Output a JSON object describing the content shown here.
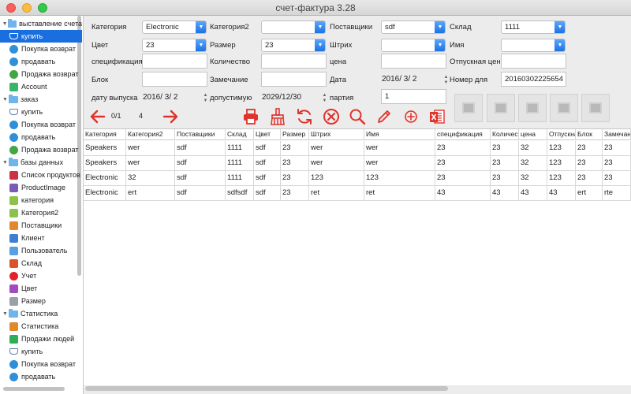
{
  "window": {
    "title": "счет-фактура 3.28"
  },
  "sidebar": {
    "items": [
      {
        "label": "выставление счета",
        "kind": "group",
        "icon": "folder-icon"
      },
      {
        "label": "купить",
        "kind": "item",
        "icon": "cart-icon",
        "selected": true
      },
      {
        "label": "Покупка возврат",
        "kind": "item",
        "icon": "globe-icon"
      },
      {
        "label": "продавать",
        "kind": "item",
        "icon": "globe-icon"
      },
      {
        "label": "Продажа возврат",
        "kind": "item",
        "icon": "refresh-icon"
      },
      {
        "label": "Account",
        "kind": "item",
        "icon": "account-icon"
      },
      {
        "label": "заказ",
        "kind": "group",
        "icon": "folder-icon"
      },
      {
        "label": "купить",
        "kind": "item",
        "icon": "cart-icon"
      },
      {
        "label": "Покупка возврат",
        "kind": "item",
        "icon": "globe-icon"
      },
      {
        "label": "продавать",
        "kind": "item",
        "icon": "globe-icon"
      },
      {
        "label": "Продажа возврат",
        "kind": "item",
        "icon": "refresh-icon"
      },
      {
        "label": "базы данных",
        "kind": "group",
        "icon": "folder-icon"
      },
      {
        "label": "Список продуктов",
        "kind": "item",
        "icon": "products-icon"
      },
      {
        "label": "ProductImage",
        "kind": "item",
        "icon": "image-icon"
      },
      {
        "label": "категория",
        "kind": "item",
        "icon": "list-icon"
      },
      {
        "label": "Категория2",
        "kind": "item",
        "icon": "list-icon"
      },
      {
        "label": "Поставщики",
        "kind": "item",
        "icon": "suppliers-icon"
      },
      {
        "label": "Клиент",
        "kind": "item",
        "icon": "clients-icon"
      },
      {
        "label": "Пользователь",
        "kind": "item",
        "icon": "user-icon"
      },
      {
        "label": "Склад",
        "kind": "item",
        "icon": "warehouse-icon"
      },
      {
        "label": "Учет",
        "kind": "item",
        "icon": "record-icon"
      },
      {
        "label": "Цвет",
        "kind": "item",
        "icon": "color-icon"
      },
      {
        "label": "Размер",
        "kind": "item",
        "icon": "size-icon"
      },
      {
        "label": "Статистика",
        "kind": "group",
        "icon": "folder-icon"
      },
      {
        "label": "Статистика",
        "kind": "item",
        "icon": "chart-icon"
      },
      {
        "label": "Продажи людей",
        "kind": "item",
        "icon": "sales-people-icon"
      },
      {
        "label": "купить",
        "kind": "item",
        "icon": "cart-icon"
      },
      {
        "label": "Покупка возврат",
        "kind": "item",
        "icon": "globe-icon"
      },
      {
        "label": "продавать",
        "kind": "item",
        "icon": "globe-icon"
      }
    ]
  },
  "form": {
    "category": {
      "label": "Категория",
      "value": "Electronic"
    },
    "category2": {
      "label": "Категория2",
      "value": ""
    },
    "suppliers": {
      "label": "Поставщики",
      "value": "sdf"
    },
    "warehouse": {
      "label": "Склад",
      "value": "1111"
    },
    "color": {
      "label": "Цвет",
      "value": "23"
    },
    "size": {
      "label": "Размер",
      "value": "23"
    },
    "barcode": {
      "label": "Штрих",
      "value": ""
    },
    "name": {
      "label": "Имя",
      "value": ""
    },
    "specification": {
      "label": "спецификация",
      "value": ""
    },
    "quantity": {
      "label": "Количество",
      "value": ""
    },
    "price": {
      "label": "цена",
      "value": ""
    },
    "sale_price": {
      "label": "Отпускная цена",
      "value": ""
    },
    "block": {
      "label": "Блок",
      "value": ""
    },
    "remark": {
      "label": "Замечание",
      "value": ""
    },
    "date": {
      "label": "Дата",
      "value": "2016/  3/  2"
    },
    "number": {
      "label": "Номер для",
      "value": "20160302225654"
    },
    "release_date": {
      "label": "дату выпуска",
      "value": "2016/  3/  2"
    },
    "valid_until": {
      "label": "допустимую",
      "value": "2029/12/30"
    },
    "batch": {
      "label": "партия",
      "value": "1"
    }
  },
  "toolbar": {
    "page": "0/1",
    "count": "4"
  },
  "table": {
    "columns": [
      "Категория",
      "Категория2",
      "Поставщики",
      "Склад",
      "Цвет",
      "Размер",
      "Штрих",
      "Имя",
      "спецификация",
      "Количество",
      "цена",
      "Отпускная цена",
      "Блок",
      "Замечание"
    ],
    "rows": [
      [
        "Speakers",
        "wer",
        "sdf",
        "1111",
        "sdf",
        "23",
        "wer",
        "wer",
        "23",
        "23",
        "32",
        "123",
        "23",
        "23"
      ],
      [
        "Speakers",
        "wer",
        "sdf",
        "1111",
        "sdf",
        "23",
        "wer",
        "wer",
        "23",
        "23",
        "32",
        "123",
        "23",
        "23"
      ],
      [
        "Electronic",
        "32",
        "sdf",
        "1111",
        "sdf",
        "23",
        "123",
        "123",
        "23",
        "23",
        "32",
        "123",
        "23",
        "23"
      ],
      [
        "Electronic",
        "ert",
        "sdf",
        "sdfsdf",
        "sdf",
        "23",
        "ret",
        "ret",
        "43",
        "43",
        "43",
        "43",
        "ert",
        "rte"
      ]
    ]
  },
  "colors": {
    "accent": "#1a6fe0",
    "toolbar_red": "#e0332b"
  }
}
